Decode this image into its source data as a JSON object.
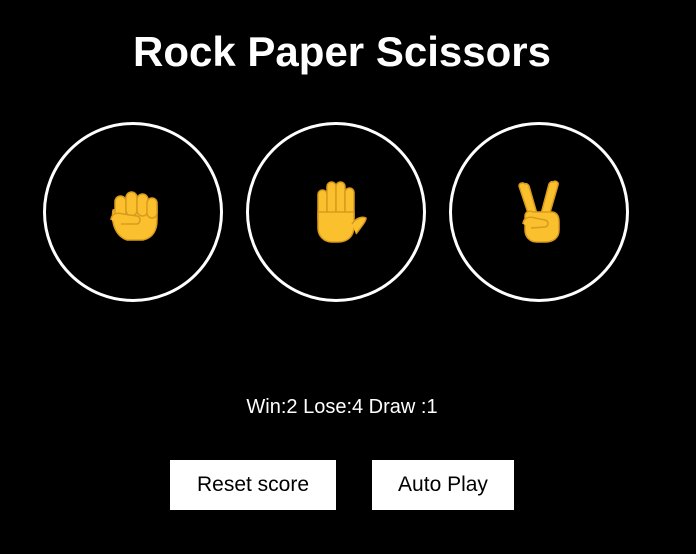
{
  "title": "Rock Paper Scissors",
  "moves": [
    {
      "name": "rock",
      "icon": "raised-fist-icon"
    },
    {
      "name": "paper",
      "icon": "raised-hand-icon"
    },
    {
      "name": "scissors",
      "icon": "victory-hand-icon"
    }
  ],
  "score": {
    "text": "Win:2 Lose:4 Draw :1",
    "wins": 2,
    "losses": 4,
    "draws": 1
  },
  "buttons": {
    "reset_label": "Reset score",
    "auto_play_label": "Auto Play"
  },
  "colors": {
    "background": "#000000",
    "foreground": "#ffffff",
    "emoji_skin": "#FBC02D",
    "emoji_outline": "#E0A020"
  }
}
